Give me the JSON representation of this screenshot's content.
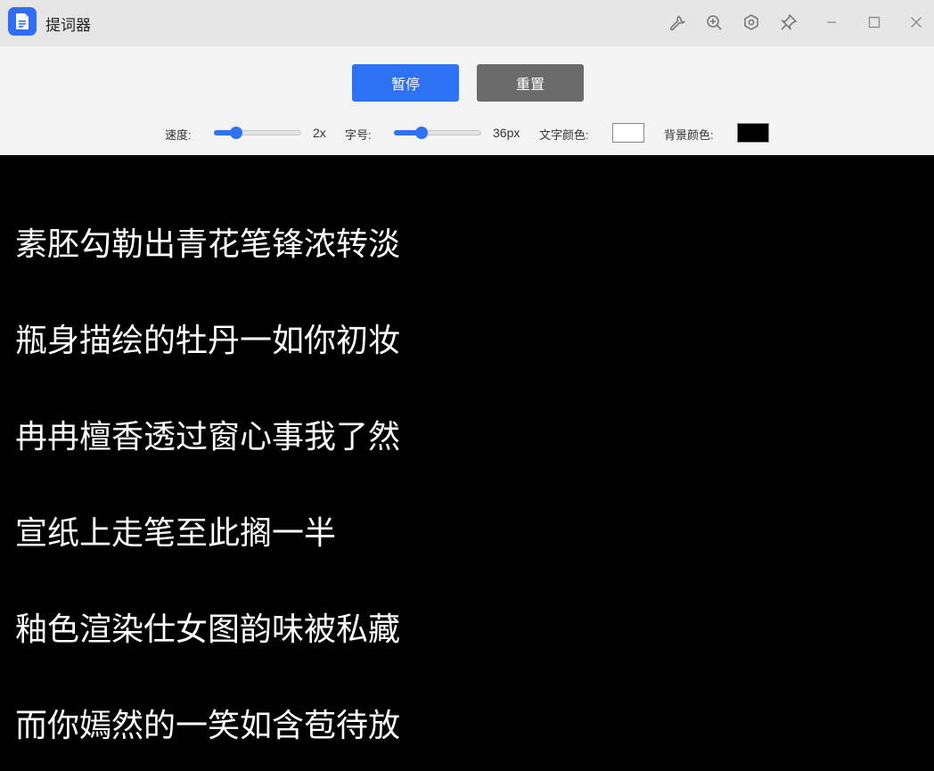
{
  "window": {
    "title": "提词器",
    "accent": "#2f6ef5"
  },
  "title_icons": [
    "wrench-icon",
    "zoom-in-icon",
    "settings-hex-icon",
    "pin-icon",
    "minimize-icon",
    "maximize-icon",
    "close-icon"
  ],
  "toolbar": {
    "pause_label": "暂停",
    "reset_label": "重置",
    "speed_label": "速度:",
    "speed_value": "2x",
    "speed_level": 0.25,
    "font_label": "字号:",
    "font_value": "36px",
    "font_level": 0.32,
    "text_color_label": "文字颜色:",
    "text_color": "#ffffff",
    "bg_color_label": "背景颜色:",
    "bg_color": "#000000"
  },
  "lines": [
    "素胚勾勒出青花笔锋浓转淡",
    "瓶身描绘的牡丹一如你初妆",
    "冉冉檀香透过窗心事我了然",
    "宣纸上走笔至此搁一半",
    "釉色渲染仕女图韵味被私藏",
    "而你嫣然的一笑如含苞待放"
  ]
}
